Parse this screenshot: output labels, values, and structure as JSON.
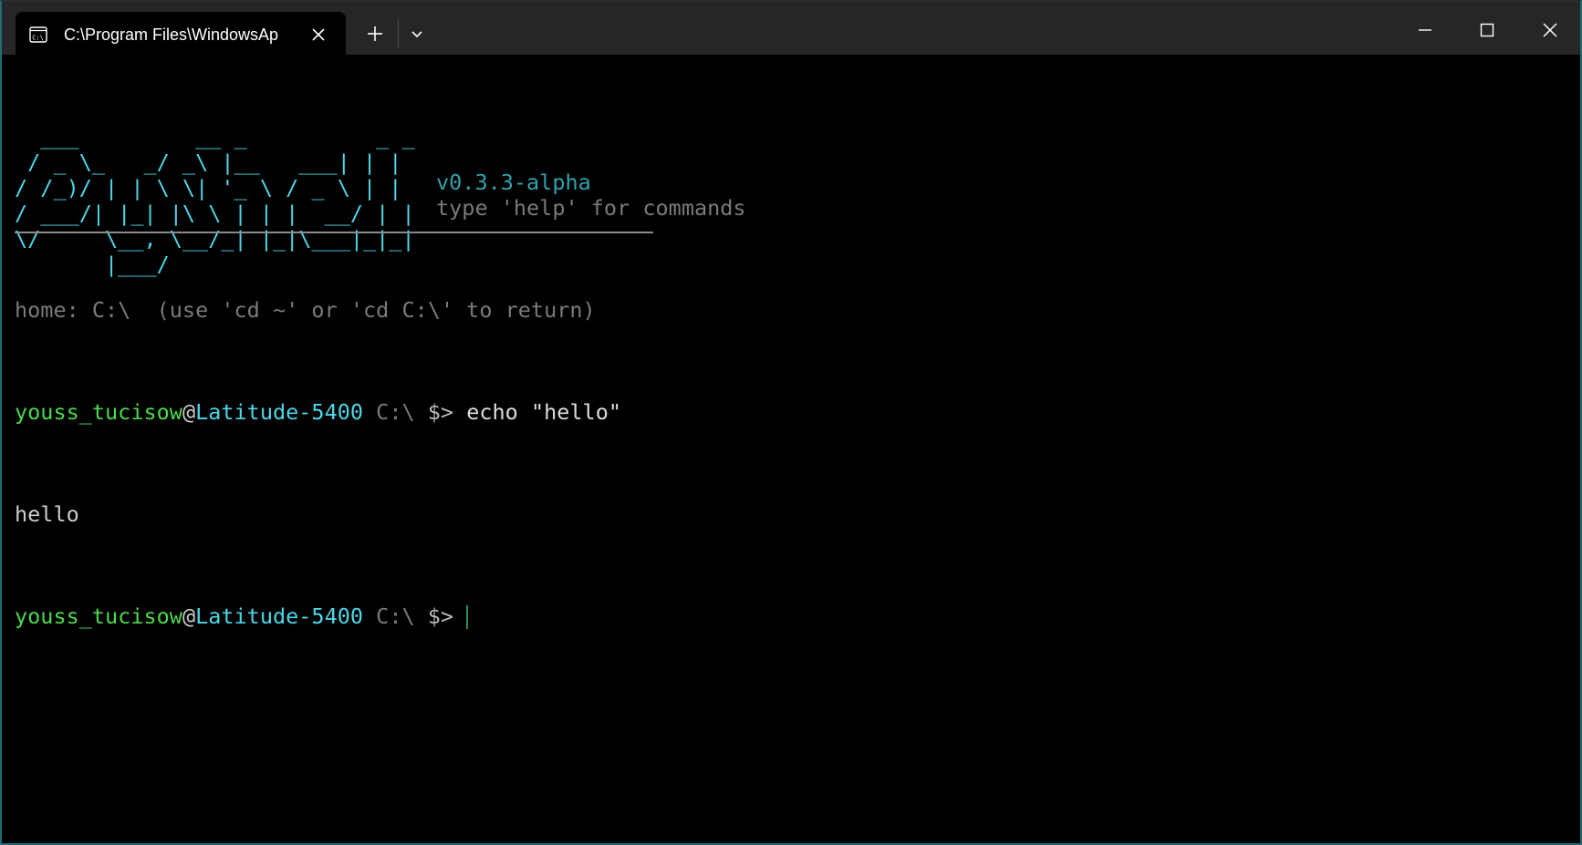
{
  "window": {
    "tab_title": "C:\\Program Files\\WindowsAp",
    "icons": {
      "tab_icon": "terminal-cmd-icon",
      "tab_close": "close-icon",
      "new_tab": "plus-icon",
      "dropdown": "chevron-down-icon",
      "minimize": "minimize-icon",
      "maximize": "maximize-icon",
      "close": "close-icon"
    }
  },
  "colors": {
    "background": "#000000",
    "titlebar": "#262626",
    "ascii_art": "#4dd6e8",
    "version": "#2fa3ae",
    "dim_text": "#7a7a7a",
    "username": "#4bd84b",
    "hostname": "#4dd6e8"
  },
  "banner": {
    "ascii_art": "  ___         __ _          _ _\n / _ \\_   _/ _\\ |__   ___| | |\n/ /_)/ | | \\ \\| '_ \\ / _ \\ | |\n/ ___/| |_| |\\ \\ | | |  __/ | |\n\\/     \\__, \\__/_| |_|\\___|_|_|\n       |___/",
    "version": "v0.3.3-alpha",
    "hint": "type 'help' for commands"
  },
  "session": {
    "home_line": "home: C:\\  (use 'cd ~' or 'cd C:\\' to return)",
    "prompt1": {
      "user": "youss_tucisow",
      "at": "@",
      "host": "Latitude-5400",
      "cwd": " C:\\ ",
      "symbol": "$>",
      "command": " echo \"hello\""
    },
    "output": "hello",
    "prompt2": {
      "user": "youss_tucisow",
      "at": "@",
      "host": "Latitude-5400",
      "cwd": " C:\\ ",
      "symbol": "$>"
    }
  }
}
